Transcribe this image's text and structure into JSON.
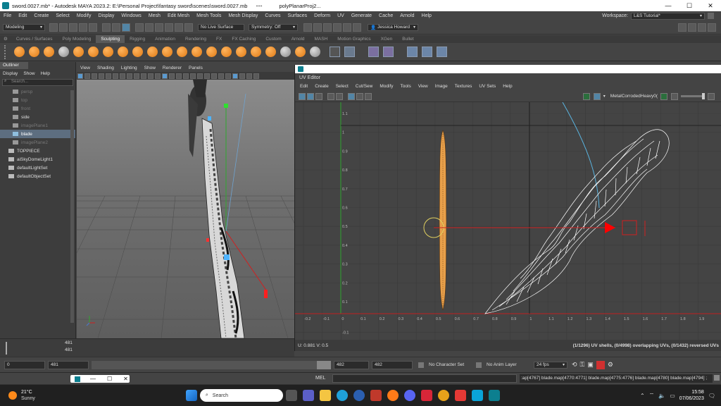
{
  "window": {
    "title": "sword.0027.mb* - Autodesk MAYA 2023.2: E:\\Personal Project\\fantasy sword\\scenes\\sword.0027.mb",
    "dots": "---",
    "second_tab": "polyPlanarProj2..."
  },
  "menu": [
    "File",
    "Edit",
    "Create",
    "Select",
    "Modify",
    "Display",
    "Windows",
    "Mesh",
    "Edit Mesh",
    "Mesh Tools",
    "Mesh Display",
    "Curves",
    "Surfaces",
    "Deform",
    "UV",
    "Generate",
    "Cache",
    "Arnold",
    "Help"
  ],
  "workspace": {
    "label": "Workspace:",
    "value": "L&S Tutorial*"
  },
  "statusline": {
    "mode": "Modeling",
    "live_surface": "No Live Surface",
    "symmetry": "Symmetry: Off",
    "user": "Jessica Howard"
  },
  "shelf_tabs": [
    "Curves / Surfaces",
    "Poly Modeling",
    "Sculpting",
    "Rigging",
    "Animation",
    "Rendering",
    "FX",
    "FX Caching",
    "Custom",
    "Arnold",
    "MASH",
    "Motion Graphics",
    "XGen",
    "Bullet"
  ],
  "active_shelf": "Sculpting",
  "outliner": {
    "title": "Outliner",
    "menu": [
      "Display",
      "Show",
      "Help"
    ],
    "search_placeholder": "Search...",
    "items": [
      {
        "label": "persp",
        "style": "dim"
      },
      {
        "label": "top",
        "style": "dim"
      },
      {
        "label": "front",
        "style": "dim"
      },
      {
        "label": "side",
        "style": "normal"
      },
      {
        "label": "imagePlane1",
        "style": "dim"
      },
      {
        "label": "blade",
        "style": "selected"
      },
      {
        "label": "imagePlane2",
        "style": "dim"
      },
      {
        "label": "TOPPIECE",
        "style": "normal"
      },
      {
        "label": "aiSkyDomeLight1",
        "style": "normal"
      },
      {
        "label": "defaultLightSet",
        "style": "normal"
      },
      {
        "label": "defaultObjectSet",
        "style": "normal"
      }
    ]
  },
  "viewport": {
    "menu": [
      "View",
      "Shading",
      "Lighting",
      "Show",
      "Renderer",
      "Panels"
    ]
  },
  "uv_editor": {
    "window_title": "",
    "name": "UV Editor",
    "menu": [
      "Edit",
      "Create",
      "Select",
      "Cut/Sew",
      "Modify",
      "Tools",
      "View",
      "Image",
      "Textures",
      "UV Sets",
      "Help"
    ],
    "texture": "MetalCorrodedHeavy0(",
    "x_ticks": [
      "-0.2",
      "-0.1",
      "0",
      "0.1",
      "0.2",
      "0.3",
      "0.4",
      "0.5",
      "0.6",
      "0.7",
      "0.8",
      "0.9",
      "1",
      "1.1",
      "1.2",
      "1.3",
      "1.4",
      "1.5",
      "1.6",
      "1.7",
      "1.8",
      "1.9"
    ],
    "y_ticks": [
      "1.1",
      "1",
      "0.9",
      "0.8",
      "0.7",
      "0.6",
      "0.5",
      "0.4",
      "0.3",
      "0.2",
      "0.1",
      "-0.1"
    ],
    "coords": "U: 0.881  V: 0.5",
    "stats": "(1/1296) UV shells, (0/4998) overlapping UVs, (0/1432) reversed UVs"
  },
  "timeslider": {
    "frame_a": "481",
    "frame_b": "481"
  },
  "range": {
    "start": "0",
    "range_start": "481",
    "range_end": "482",
    "end": "482",
    "character_set": "No Character Set",
    "anim_layer": "No Anim Layer",
    "fps": "24 fps"
  },
  "cmdline": {
    "lang": "MEL",
    "history": ":ap[4767] blade.map[4770:4771] blade.map[4775:4776] blade.map[4780] blade.map[4794] ;"
  },
  "taskbar": {
    "temp": "21°C",
    "weather": "Sunny",
    "search": "Search",
    "time": "15:58",
    "date": "07/06/2023"
  },
  "colors": {
    "accent_blue": "#5285a6",
    "uv_shell": "#e8a04a",
    "mesh_wire": "#ffffff",
    "manip_red": "#ff0000",
    "axis_green": "#2fa82f"
  }
}
